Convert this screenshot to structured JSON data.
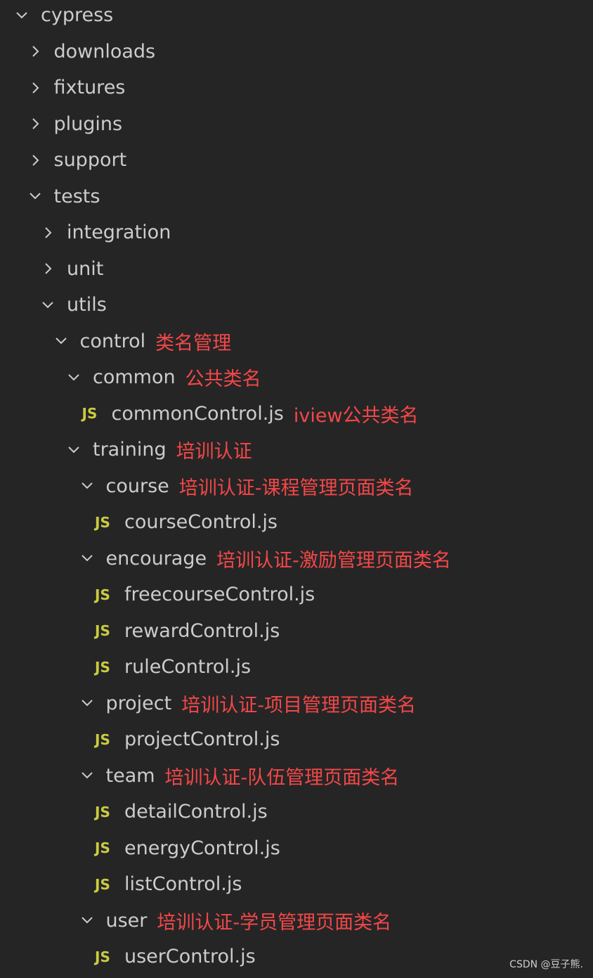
{
  "tree": [
    {
      "label": "cypress",
      "kind": "folder",
      "expanded": true,
      "depth": 0,
      "note": ""
    },
    {
      "label": "downloads",
      "kind": "folder",
      "expanded": false,
      "depth": 1,
      "note": ""
    },
    {
      "label": "fixtures",
      "kind": "folder",
      "expanded": false,
      "depth": 1,
      "note": ""
    },
    {
      "label": "plugins",
      "kind": "folder",
      "expanded": false,
      "depth": 1,
      "note": ""
    },
    {
      "label": "support",
      "kind": "folder",
      "expanded": false,
      "depth": 1,
      "note": ""
    },
    {
      "label": "tests",
      "kind": "folder",
      "expanded": true,
      "depth": 1,
      "note": ""
    },
    {
      "label": "integration",
      "kind": "folder",
      "expanded": false,
      "depth": 2,
      "note": ""
    },
    {
      "label": "unit",
      "kind": "folder",
      "expanded": false,
      "depth": 2,
      "note": ""
    },
    {
      "label": "utils",
      "kind": "folder",
      "expanded": true,
      "depth": 2,
      "note": ""
    },
    {
      "label": "control",
      "kind": "folder",
      "expanded": true,
      "depth": 3,
      "note": "类名管理"
    },
    {
      "label": "common",
      "kind": "folder",
      "expanded": true,
      "depth": 4,
      "note": "公共类名"
    },
    {
      "label": "commonControl.js",
      "kind": "file",
      "depth": 5,
      "note": "iview公共类名"
    },
    {
      "label": "training",
      "kind": "folder",
      "expanded": true,
      "depth": 4,
      "note": "培训认证"
    },
    {
      "label": "course",
      "kind": "folder",
      "expanded": true,
      "depth": 5,
      "note": "培训认证-课程管理页面类名"
    },
    {
      "label": "courseControl.js",
      "kind": "file",
      "depth": 6,
      "note": ""
    },
    {
      "label": "encourage",
      "kind": "folder",
      "expanded": true,
      "depth": 5,
      "note": "培训认证-激励管理页面类名"
    },
    {
      "label": "freecourseControl.js",
      "kind": "file",
      "depth": 6,
      "note": ""
    },
    {
      "label": "rewardControl.js",
      "kind": "file",
      "depth": 6,
      "note": ""
    },
    {
      "label": "ruleControl.js",
      "kind": "file",
      "depth": 6,
      "note": ""
    },
    {
      "label": "project",
      "kind": "folder",
      "expanded": true,
      "depth": 5,
      "note": "培训认证-项目管理页面类名"
    },
    {
      "label": "projectControl.js",
      "kind": "file",
      "depth": 6,
      "note": ""
    },
    {
      "label": "team",
      "kind": "folder",
      "expanded": true,
      "depth": 5,
      "note": "培训认证-队伍管理页面类名"
    },
    {
      "label": "detailControl.js",
      "kind": "file",
      "depth": 6,
      "note": ""
    },
    {
      "label": "energyControl.js",
      "kind": "file",
      "depth": 6,
      "note": ""
    },
    {
      "label": "listControl.js",
      "kind": "file",
      "depth": 6,
      "note": ""
    },
    {
      "label": "user",
      "kind": "folder",
      "expanded": true,
      "depth": 5,
      "note": "培训认证-学员管理页面类名"
    },
    {
      "label": "userControl.js",
      "kind": "file",
      "depth": 6,
      "note": ""
    }
  ],
  "file_icon_text": "JS",
  "watermark": "CSDN @豆子熊.",
  "colors": {
    "background": "#252526",
    "label": "#cccccc",
    "note": "#f44747",
    "js_icon": "#cbcb41"
  }
}
